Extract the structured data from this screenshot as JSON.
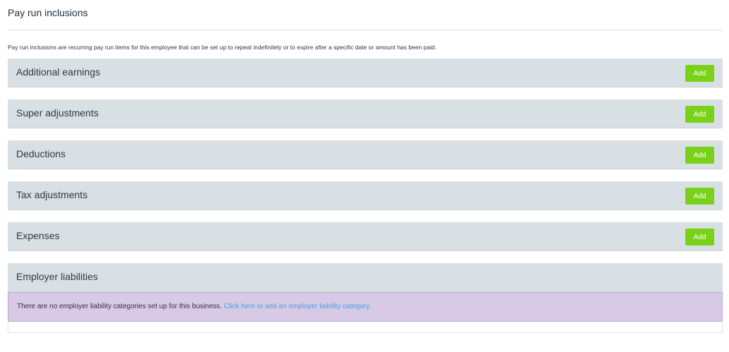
{
  "page": {
    "title": "Pay run inclusions",
    "intro": "Pay run inclusions are recurring pay run items for this employee that can be set up to repeat indefinitely or to expire after a specific date or amount has been paid."
  },
  "sections": [
    {
      "title": "Additional earnings",
      "add_label": "Add"
    },
    {
      "title": "Super adjustments",
      "add_label": "Add"
    },
    {
      "title": "Deductions",
      "add_label": "Add"
    },
    {
      "title": "Tax adjustments",
      "add_label": "Add"
    },
    {
      "title": "Expenses",
      "add_label": "Add"
    },
    {
      "title": "Employer liabilities"
    }
  ],
  "employer_liabilities": {
    "message": "There are no employer liability categories set up for this business.",
    "link_text": "Click here to add an employer liability category."
  },
  "colors": {
    "section_bg": "#d9e0e4",
    "add_button": "#79d11a",
    "alert_bg": "#d8c9e6",
    "link": "#4aa3df"
  }
}
